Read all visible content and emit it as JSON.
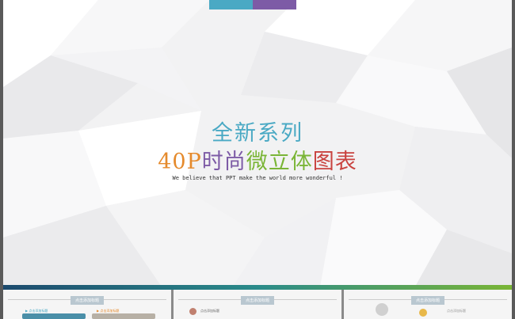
{
  "colors": {
    "teal": "#4aa9c4",
    "purple": "#7d5ba6",
    "orange": "#e58a2c",
    "green": "#7ab536",
    "red": "#c9433f",
    "blue": "#2f6fb1"
  },
  "slide": {
    "title_line1": "全新系列",
    "title_line2": [
      {
        "text": "40P",
        "color": "#e58a2c"
      },
      {
        "text": "时尚",
        "color": "#7d5ba6"
      },
      {
        "text": "微立体",
        "color": "#7ab536"
      },
      {
        "text": "图表",
        "color": "#c9433f"
      }
    ],
    "tagline": "We believe that PPT make the world more wonderful !"
  },
  "thumbnails": [
    {
      "title": "点击添加标题",
      "tags": [
        "▶ 点击添加标题",
        "▶ 点击添加标题"
      ]
    },
    {
      "title": "点击添加标题",
      "tags": [
        "点击添加标题"
      ]
    },
    {
      "title": "点击添加标题",
      "tags": [
        "点击添加标题"
      ]
    }
  ]
}
